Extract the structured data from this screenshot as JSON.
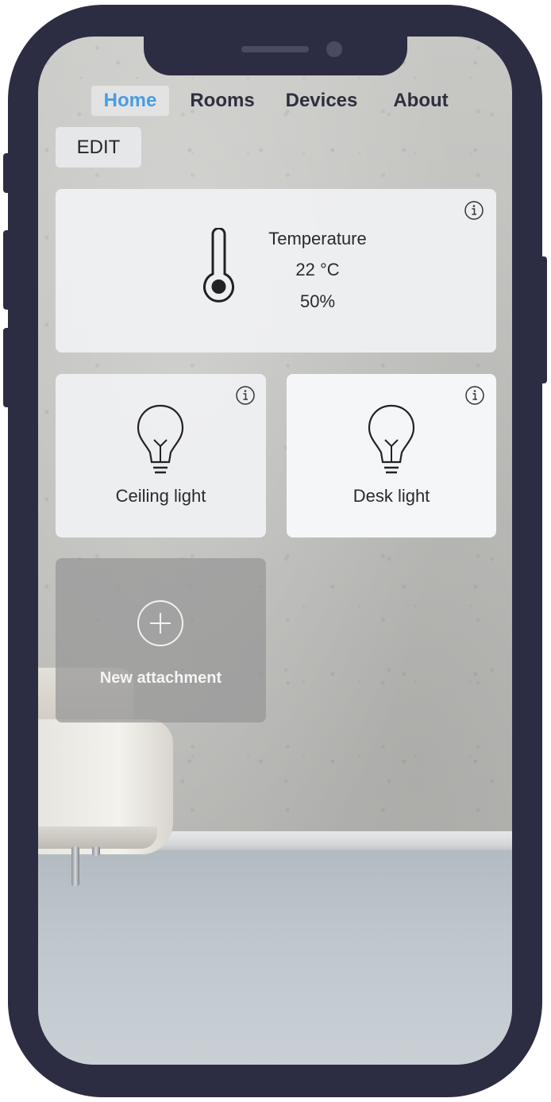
{
  "nav": {
    "items": [
      {
        "label": "Home",
        "active": true
      },
      {
        "label": "Rooms",
        "active": false
      },
      {
        "label": "Devices",
        "active": false
      },
      {
        "label": "About",
        "active": false
      }
    ],
    "active_color": "#4a9ce0"
  },
  "edit_label": "EDIT",
  "temperature_card": {
    "title": "Temperature",
    "temperature": "22 °C",
    "humidity": "50%",
    "icon": "thermometer-icon"
  },
  "devices": [
    {
      "label": "Ceiling light",
      "icon": "lightbulb-icon"
    },
    {
      "label": "Desk light",
      "icon": "lightbulb-icon"
    }
  ],
  "new_attachment": {
    "label": "New attachment",
    "icon": "plus-circle-icon"
  },
  "colors": {
    "phone_frame": "#2c2d42",
    "card_bg": "#f0f1f3"
  }
}
